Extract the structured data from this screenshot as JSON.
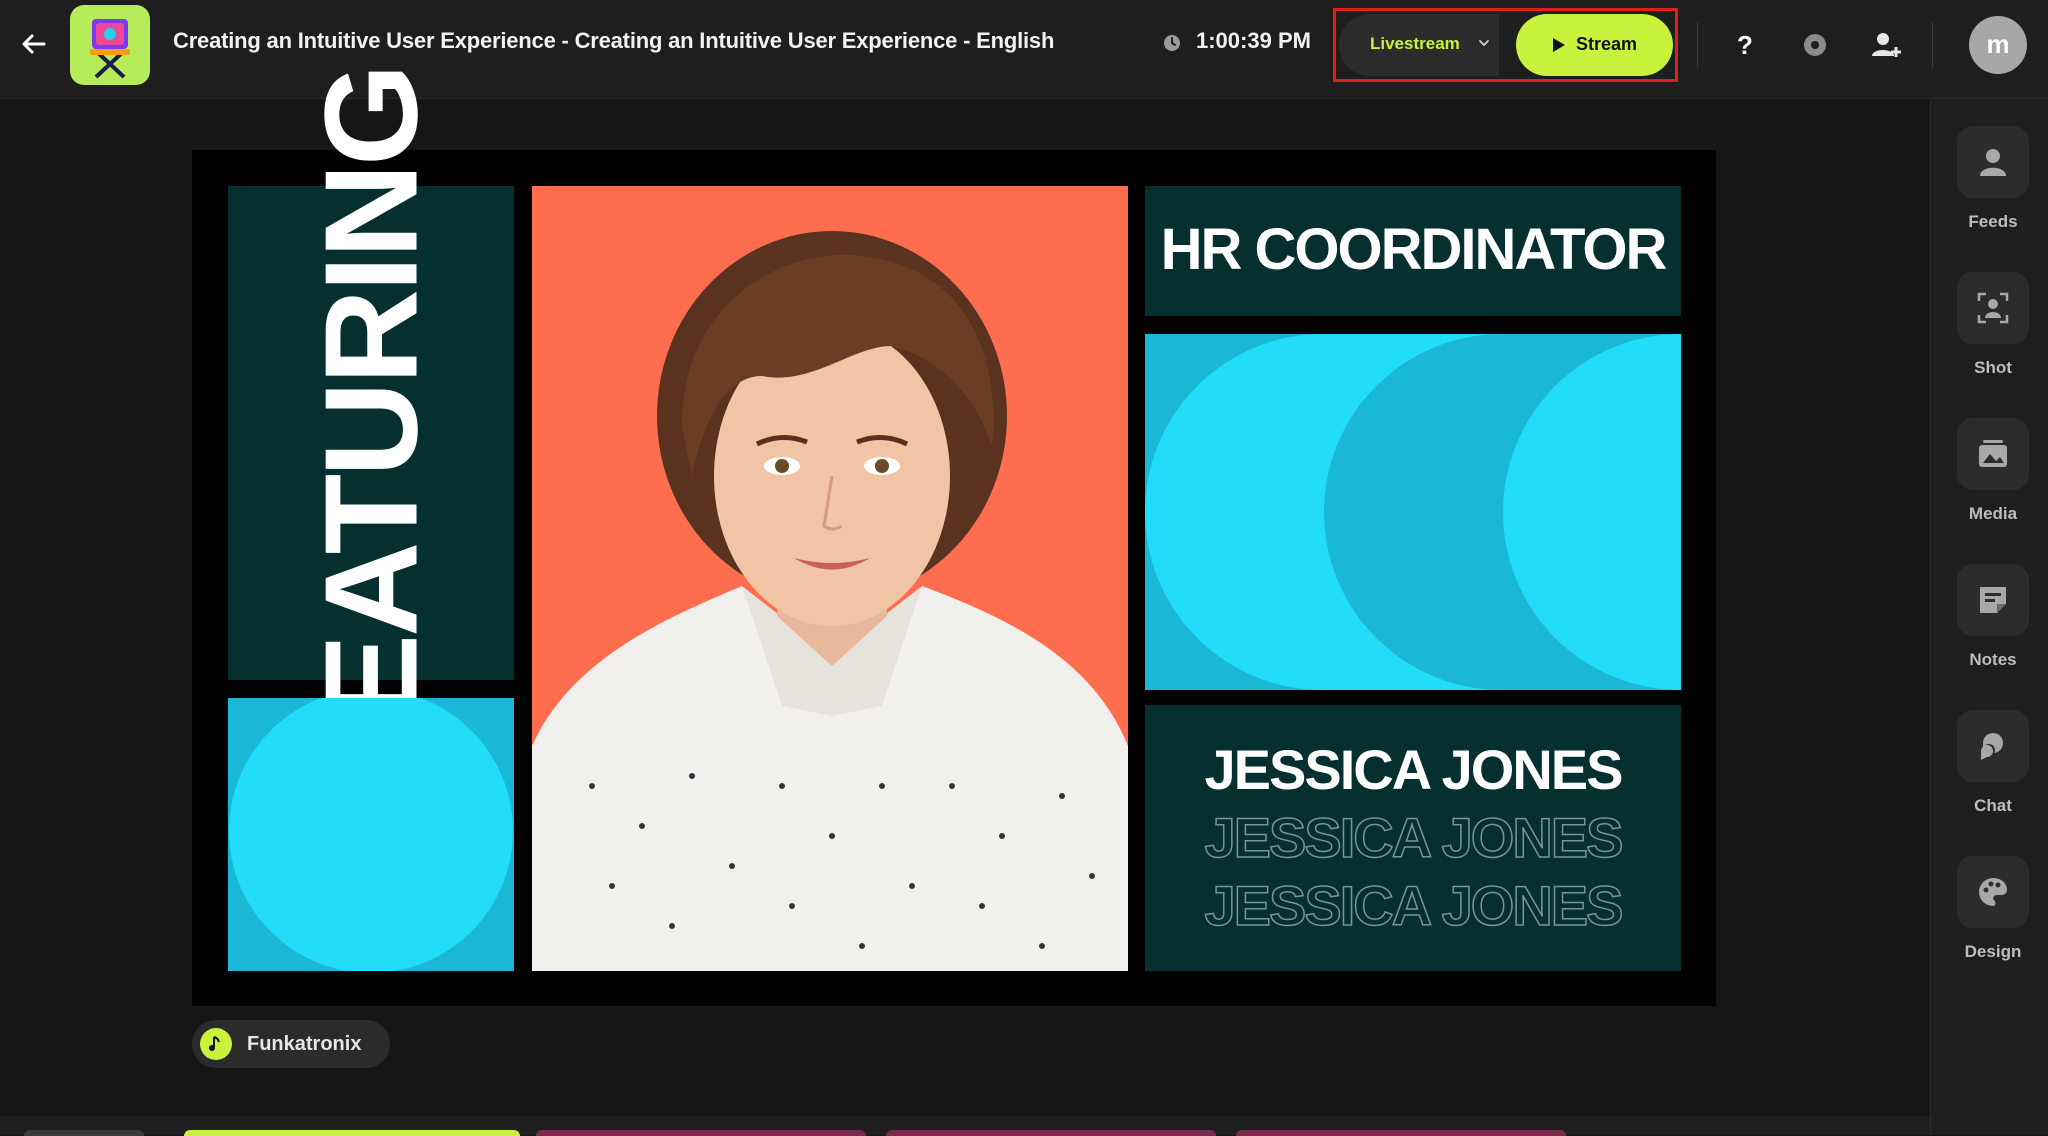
{
  "header": {
    "title": "Creating an Intuitive User Experience - Creating an Intuitive User Experience - English",
    "time": "1:00:39 PM",
    "livestream_label": "Livestream",
    "stream_label": "Stream",
    "avatar_initial": "m"
  },
  "sidebar": {
    "items": [
      {
        "label": "Feeds",
        "icon": "person-icon"
      },
      {
        "label": "Shot",
        "icon": "focus-person-icon"
      },
      {
        "label": "Media",
        "icon": "image-icon"
      },
      {
        "label": "Notes",
        "icon": "note-icon"
      },
      {
        "label": "Chat",
        "icon": "chat-icon"
      },
      {
        "label": "Design",
        "icon": "palette-icon"
      }
    ]
  },
  "stage": {
    "featuring": "FEATURING",
    "role": "HR COORDINATOR",
    "name": "JESSICA JONES"
  },
  "music": {
    "label": "Funkatronix"
  },
  "colors": {
    "accent": "#c9f23c",
    "stage_dark": "#05302f",
    "stage_cyan": "#1ab8d6",
    "stage_bright_cyan": "#22dcfa",
    "photo_bg": "#ff6d4f",
    "highlight": "#e0211b"
  }
}
